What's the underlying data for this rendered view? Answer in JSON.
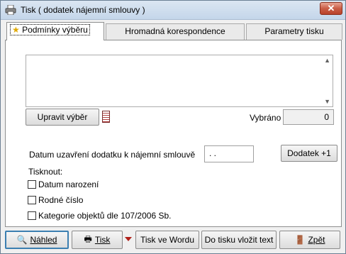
{
  "window": {
    "title": "Tisk ( dodatek nájemní smlouvy )",
    "close_symbol": "✕"
  },
  "tabs": [
    {
      "label": "Podmínky výběru",
      "active": true,
      "icon": "star-icon"
    },
    {
      "label": "Hromadná korespondence",
      "active": false
    },
    {
      "label": "Parametry tisku",
      "active": false
    }
  ],
  "filter": {
    "edit_button": "Upravit výběr",
    "selected_label": "Vybráno",
    "selected_count": "0"
  },
  "contract": {
    "date_label": "Datum uzavření dodatku k nájemní smlouvě",
    "date_value": " . .",
    "addendum_button": "Dodatek +1"
  },
  "print_options": {
    "heading": "Tisknout:",
    "items": [
      {
        "label": "Datum narození",
        "checked": false
      },
      {
        "label": "Rodné číslo",
        "checked": false
      },
      {
        "label": "Kategorie objektů dle 107/2006 Sb.",
        "checked": false
      }
    ]
  },
  "buttons": {
    "preview": "Náhled",
    "print": "Tisk",
    "print_word": "Tisk ve Wordu",
    "insert_print": "Do tisku vložit text",
    "back": "Zpět"
  },
  "colors": {
    "titlebar": "#c4d6ea",
    "close_button": "#c95d46",
    "face": "#f0f0f0"
  }
}
